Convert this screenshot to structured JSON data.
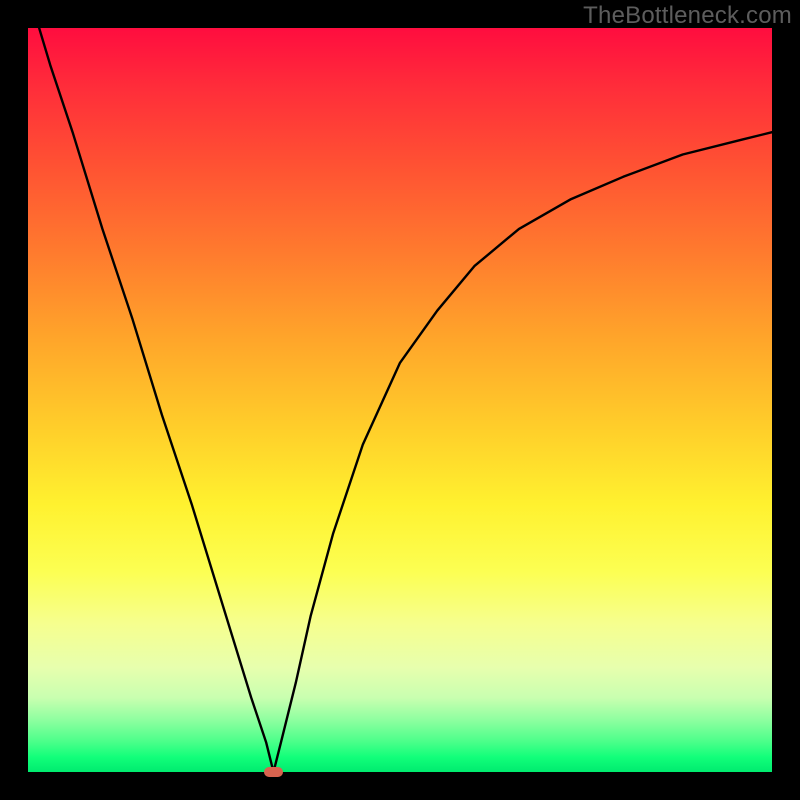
{
  "watermark": "TheBottleneck.com",
  "colors": {
    "frame": "#000000",
    "curve": "#000000",
    "marker": "#d8634f",
    "gradient_stops": [
      "#ff0d3f",
      "#ff2d3a",
      "#ff5033",
      "#ff7a2e",
      "#ffa62a",
      "#ffcf2a",
      "#fff12f",
      "#fcff52",
      "#f6ff8e",
      "#e7ffae",
      "#c9ffb0",
      "#8effa0",
      "#49ff89",
      "#12ff7a",
      "#00eb6f"
    ]
  },
  "chart_data": {
    "type": "line",
    "title": "",
    "xlabel": "",
    "ylabel": "",
    "xlim": [
      0,
      100
    ],
    "ylim": [
      0,
      100
    ],
    "grid": false,
    "note": "Single V-shaped curve; bottleneck minimum at x≈33, y≈0. Values estimated from pixel positions (no axis/tick labels present). Marker ellipse at the minimum.",
    "series": [
      {
        "name": "curve",
        "x": [
          0,
          3,
          6,
          10,
          14,
          18,
          22,
          26,
          30,
          32,
          33,
          34,
          36,
          38,
          41,
          45,
          50,
          55,
          60,
          66,
          73,
          80,
          88,
          96,
          100
        ],
        "y": [
          105,
          95,
          86,
          73,
          61,
          48,
          36,
          23,
          10,
          4,
          0,
          4,
          12,
          21,
          32,
          44,
          55,
          62,
          68,
          73,
          77,
          80,
          83,
          85,
          86
        ]
      }
    ],
    "marker": {
      "x": 33,
      "y": 0,
      "shape": "ellipse",
      "rx": 1.3,
      "ry": 0.7
    }
  }
}
